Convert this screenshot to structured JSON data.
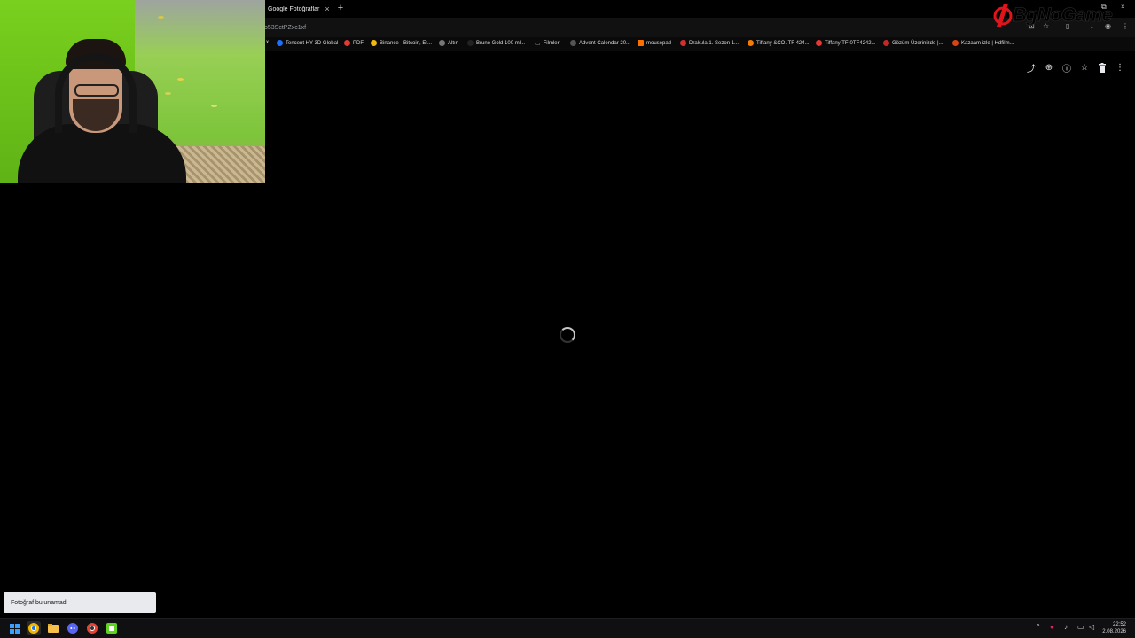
{
  "browser": {
    "active_tab_title": "Google Fotoğraflar",
    "tab_close_glyph": "×",
    "new_tab_glyph": "+",
    "url": "o53SctPZxc1xf",
    "window_controls": [
      "⧉",
      "×"
    ]
  },
  "bookmarks": [
    {
      "label": "x",
      "favicon_color": "#444444"
    },
    {
      "label": "Tencent HY 3D Global",
      "favicon_color": "#1e6fff"
    },
    {
      "label": "PDF",
      "favicon_color": "#e53935"
    },
    {
      "label": "Binance - Bitcoin, Et...",
      "favicon_color": "#f0b90b"
    },
    {
      "label": "Altın",
      "favicon_color": "#777777"
    },
    {
      "label": "Bruno Gold 100 ml...",
      "favicon_color": "#222222"
    },
    {
      "label": "Filmler",
      "favicon_color": "#9aa0a6"
    },
    {
      "label": "Advent Calendar 20...",
      "favicon_color": "#555555"
    },
    {
      "label": "mousepad",
      "favicon_color": "#ff6f00"
    },
    {
      "label": "Drakula 1. Sezon 1...",
      "favicon_color": "#d32f2f"
    },
    {
      "label": "Tiffany &CO. TF 424...",
      "favicon_color": "#f57c00"
    },
    {
      "label": "Tiffany TF-0TF4242...",
      "favicon_color": "#e53935"
    },
    {
      "label": "Gözüm Üzerinizde |...",
      "favicon_color": "#c62828"
    },
    {
      "label": "Kazaam izle | Hdfilm...",
      "favicon_color": "#d84315"
    }
  ],
  "brand": {
    "text": "BgNoGame",
    "accent": "#e0151b"
  },
  "viewer_actions": [
    {
      "name": "share-icon",
      "glyph": "⤴"
    },
    {
      "name": "zoom-in-icon",
      "glyph": "⊕"
    },
    {
      "name": "info-icon",
      "glyph": "ⓘ"
    },
    {
      "name": "star-icon",
      "glyph": "☆"
    },
    {
      "name": "trash-icon",
      "glyph": "🗑"
    },
    {
      "name": "more-vert-icon",
      "glyph": "⋮"
    }
  ],
  "toast": {
    "message": "Fotoğraf bulunamadı"
  },
  "taskbar": {
    "apps": [
      {
        "name": "windows-start-icon",
        "color": "#3aa0ff"
      },
      {
        "name": "chrome-icon",
        "color": "#f2b600"
      },
      {
        "name": "file-explorer-icon",
        "color": "#f7c04a"
      },
      {
        "name": "discord-icon",
        "color": "#5865f2"
      },
      {
        "name": "chrome-canary-icon",
        "color": "#e94235"
      },
      {
        "name": "android-app-icon",
        "color": "#5fd31f"
      }
    ],
    "time": "22:52",
    "date": "2.08.2026"
  }
}
